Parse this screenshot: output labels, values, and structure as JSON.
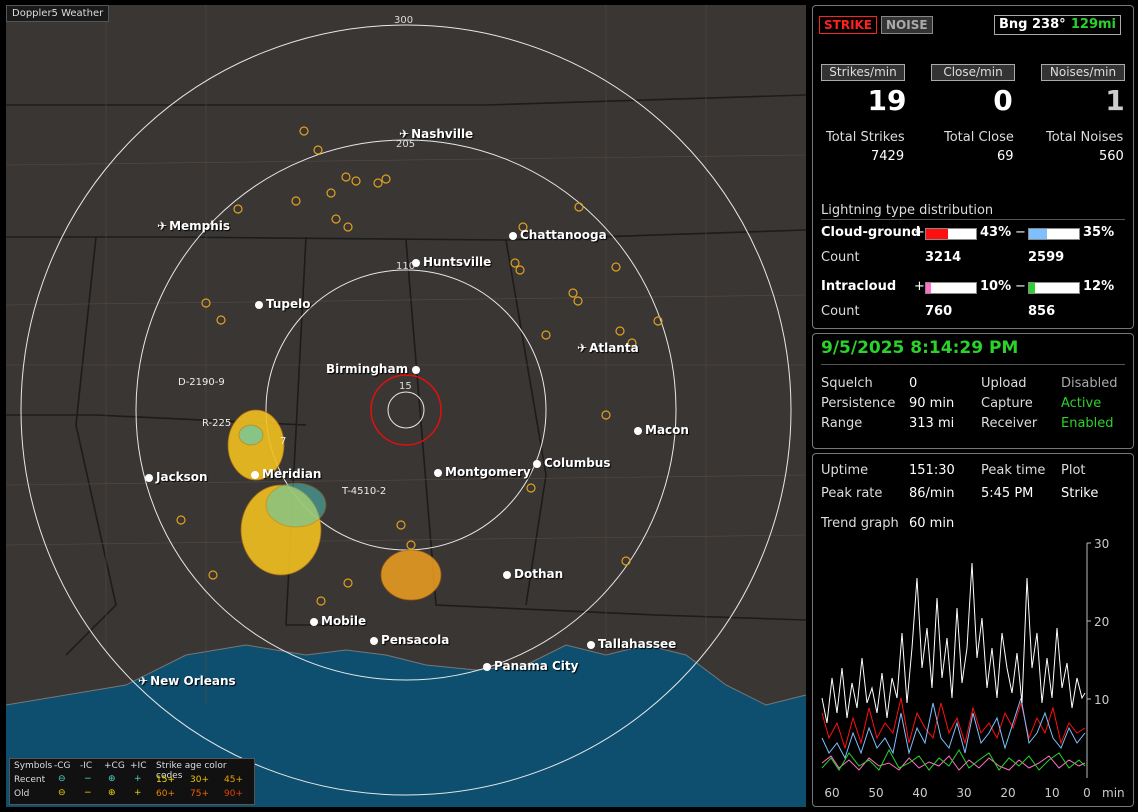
{
  "brand": "Doppler5 Weather",
  "header": {
    "strike_tag": "STRIKE",
    "noise_tag": "NOISE",
    "bearing": "Bng 238°",
    "distance": "129mi"
  },
  "rates": {
    "strikes_label": "Strikes/min",
    "close_label": "Close/min",
    "noises_label": "Noises/min",
    "strikes": "19",
    "close": "0",
    "noises": "1"
  },
  "totals": {
    "strikes_label": "Total Strikes",
    "close_label": "Total Close",
    "noises_label": "Total Noises",
    "strikes": "7429",
    "close": "69",
    "noises": "560"
  },
  "distribution": {
    "title": "Lightning type distribution",
    "cg_label": "Cloud-ground",
    "ic_label": "Intracloud",
    "count_label": "Count",
    "plus": "+",
    "minus": "−",
    "cg_pos_pct": "43%",
    "cg_neg_pct": "35%",
    "cg_pos_count": "3214",
    "cg_neg_count": "2599",
    "ic_pos_pct": "10%",
    "ic_neg_pct": "12%",
    "ic_pos_count": "760",
    "ic_neg_count": "856",
    "cg_pos_fill": 0.43,
    "cg_neg_fill": 0.35,
    "ic_pos_fill": 0.1,
    "ic_neg_fill": 0.12
  },
  "status": {
    "datetime": "9/5/2025 8:14:29 PM",
    "squelch_label": "Squelch",
    "squelch": "0",
    "persistence_label": "Persistence",
    "persistence": "90 min",
    "range_label": "Range",
    "range": "313 mi",
    "upload_label": "Upload",
    "upload": "Disabled",
    "capture_label": "Capture",
    "capture": "Active",
    "receiver_label": "Receiver",
    "receiver": "Enabled"
  },
  "stats": {
    "uptime_label": "Uptime",
    "uptime": "151:30",
    "peak_time_label": "Peak time",
    "peak_time": "5:45 PM",
    "plot_label": "Plot",
    "plot": "Strike",
    "peak_rate_label": "Peak rate",
    "peak_rate": "86/min",
    "trend_label": "Trend graph",
    "trend": "60 min"
  },
  "trend_axis": {
    "y": [
      "30",
      "20",
      "10"
    ],
    "x": [
      "60",
      "50",
      "40",
      "30",
      "20",
      "10",
      "0"
    ],
    "unit": "min"
  },
  "map": {
    "range_labels": [
      "300",
      "205",
      "110",
      "15"
    ],
    "cities": [
      "Nashville",
      "Memphis",
      "Chattanooga",
      "Huntsville",
      "Tupelo",
      "Atlanta",
      "Birmingham",
      "Macon",
      "Jackson",
      "Meridian",
      "Montgomery",
      "Columbus",
      "Dothan",
      "Mobile",
      "Pensacola",
      "Tallahassee",
      "Panama City",
      "New Orleans"
    ],
    "tracks": [
      "D-2190-9",
      "R-225",
      "7",
      "T-4510-2"
    ]
  },
  "legend": {
    "symbols": "Symbols",
    "neg_cg": "-CG",
    "neg_ic": "-IC",
    "pos_cg": "+CG",
    "pos_ic": "+IC",
    "age_title": "Strike age color codes",
    "recent": "Recent",
    "old": "Old",
    "a15": "15+",
    "a30": "30+",
    "a45": "45+",
    "a60": "60+",
    "a75": "75+",
    "a90": "90+"
  },
  "colors": {
    "cg_pos": "#ff1010",
    "cg_neg": "#7ec0ff",
    "ic_pos": "#ff6ec7",
    "ic_neg": "#2bd22b",
    "accent_green": "#2bd22b"
  }
}
